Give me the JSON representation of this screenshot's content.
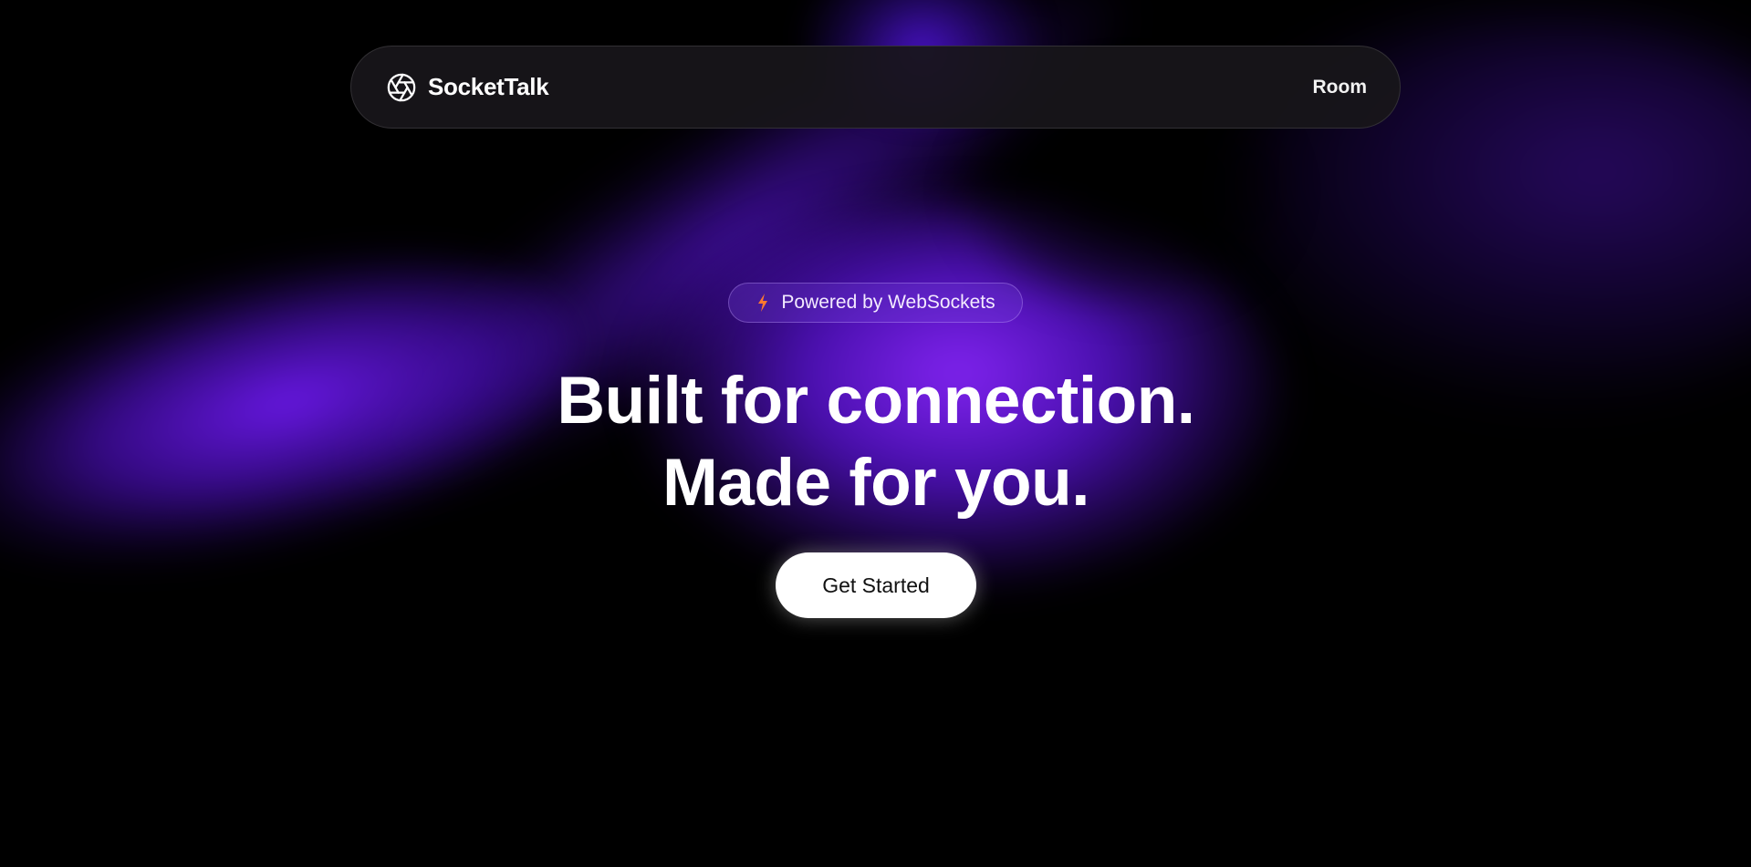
{
  "brand": {
    "name": "SocketTalk",
    "icon": "aperture-icon"
  },
  "nav": {
    "room_label": "Room"
  },
  "hero": {
    "badge_icon": "lightning-bolt-icon",
    "badge_text": "Powered by WebSockets",
    "headline_line1": "Built for connection.",
    "headline_line2": "Made for you.",
    "cta_label": "Get Started"
  },
  "colors": {
    "background": "#000000",
    "accent_purple": "#8A26FF",
    "bolt_orange": "#FF7A2F",
    "cta_background": "#FFFFFF"
  }
}
